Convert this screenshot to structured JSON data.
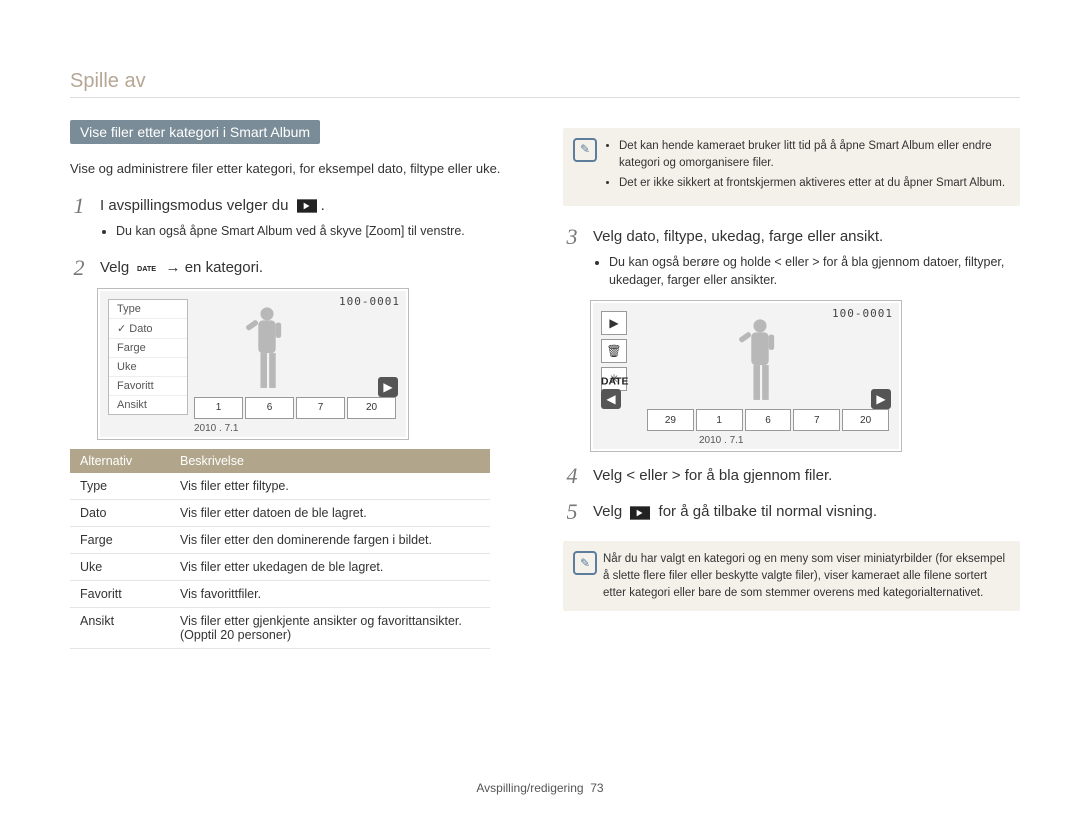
{
  "page_title": "Spille av",
  "section_heading": "Vise ﬁler etter kategori i Smart Album",
  "intro": "Vise og administrere ﬁler etter kategori, for eksempel dato, ﬁltype eller uke.",
  "steps": [
    {
      "num": "1",
      "text_pre": "I avspillingsmodus velger du ",
      "icon": "play-in",
      "text_post": ".",
      "bullets": [
        "Du kan også åpne Smart Album ved å skyve [Zoom] til venstre."
      ]
    },
    {
      "num": "2",
      "text_pre": "Velg ",
      "icon": "date",
      "text_post": " → en kategori."
    },
    {
      "num": "3",
      "text_pre": "Velg dato, ﬁltype, ukedag, farge eller ansikt.",
      "bullets": [
        "Du kan også berøre og holde < eller > for å bla gjennom datoer, ﬁltyper, ukedager, farger eller ansikter."
      ]
    },
    {
      "num": "4",
      "text_pre": "Velg < eller > for å bla gjennom ﬁler."
    },
    {
      "num": "5",
      "text_pre": "Velg ",
      "icon": "play-in",
      "text_post": " for å gå tilbake til normal visning."
    }
  ],
  "screenshot_left": {
    "dropdown": [
      "Type",
      "Dato",
      "Farge",
      "Uke",
      "Favoritt",
      "Ansikt"
    ],
    "checked_index": 1,
    "counter": "100-0001",
    "filmstrip": [
      "1",
      "6",
      "7",
      "20"
    ],
    "date": "2010 . 7.1"
  },
  "screenshot_right": {
    "vbtns": [
      "▶",
      "🗑",
      "✳"
    ],
    "counter": "100-0001",
    "filmstrip": [
      "29",
      "1",
      "6",
      "7",
      "20"
    ],
    "date": "2010 . 7.1"
  },
  "table": {
    "headers": [
      "Alternativ",
      "Beskrivelse"
    ],
    "rows": [
      [
        "Type",
        "Vis ﬁler etter ﬁltype."
      ],
      [
        "Dato",
        "Vis ﬁler etter datoen de ble lagret."
      ],
      [
        "Farge",
        "Vis ﬁler etter den dominerende fargen i bildet."
      ],
      [
        "Uke",
        "Vis ﬁler etter ukedagen de ble lagret."
      ],
      [
        "Favoritt",
        "Vis favorittﬁler."
      ],
      [
        "Ansikt",
        "Vis ﬁler etter gjenkjente ansikter og favorittansikter. (Opptil 20 personer)"
      ]
    ]
  },
  "notes": {
    "top": [
      "Det kan hende kameraet bruker litt tid på å åpne Smart Album eller endre kategori og omorganisere ﬁler.",
      "Det er ikke sikkert at frontskjermen aktiveres etter at du åpner Smart Album."
    ],
    "bottom": "Når du har valgt en kategori og en meny som viser miniatyrbilder (for eksempel å slette ﬂere ﬁler eller beskytte valgte ﬁler), viser kameraet alle ﬁlene sortert etter kategori eller bare de som stemmer overens med kategorialternativet."
  },
  "footer": {
    "section": "Avspilling/redigering",
    "page": "73"
  }
}
